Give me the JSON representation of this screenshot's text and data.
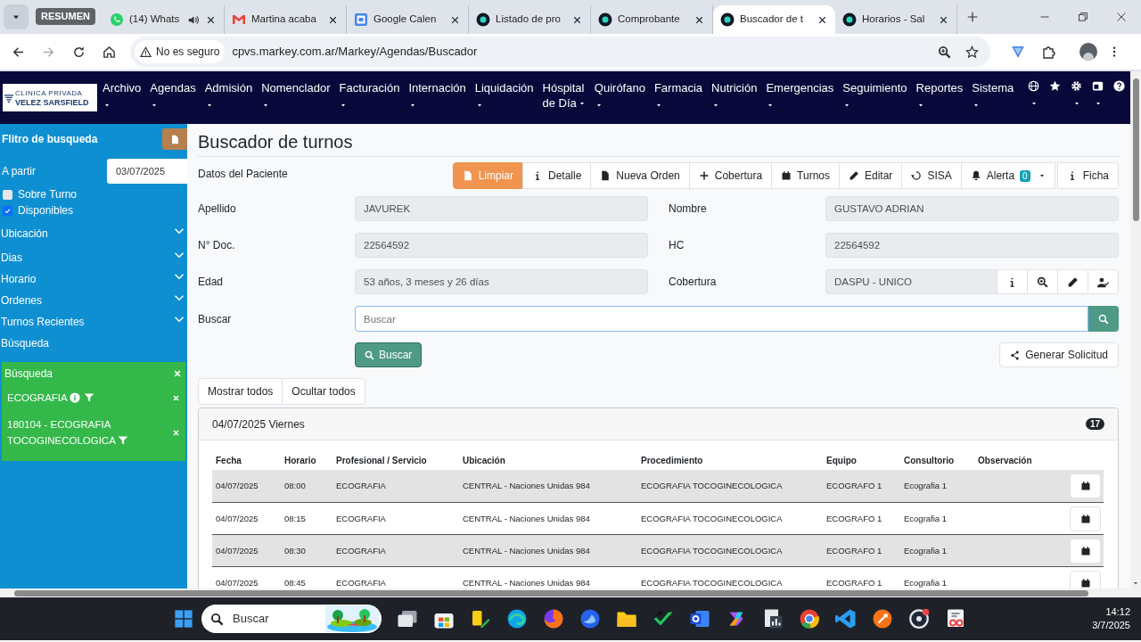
{
  "browser": {
    "tab_group": "RESUMEN",
    "tabs": [
      {
        "title": "(14) Whats",
        "kind": "chat",
        "audio": true,
        "selected": false
      },
      {
        "title": "Martina acaba",
        "kind": "mail",
        "audio": false,
        "selected": false
      },
      {
        "title": "Google Calen",
        "kind": "calendar",
        "audio": false,
        "selected": false
      },
      {
        "title": "Listado de pro",
        "kind": "site",
        "audio": false,
        "selected": false
      },
      {
        "title": "Comprobante",
        "kind": "site",
        "audio": false,
        "selected": false
      },
      {
        "title": "Buscador de t",
        "kind": "site",
        "audio": false,
        "selected": true
      },
      {
        "title": "Horarios - Sal",
        "kind": "site",
        "audio": false,
        "selected": false
      }
    ],
    "address": {
      "security": "No es seguro",
      "url": "cpvs.markey.com.ar/Markey/Agendas/Buscador"
    }
  },
  "app": {
    "logo": {
      "line_1": "CLINICA PRIVADA",
      "line_2": "VELEZ SARSFIELD"
    },
    "menu": [
      {
        "label": "Archivo"
      },
      {
        "label": "Agendas"
      },
      {
        "label": "Admisión"
      },
      {
        "label": "Nomenclador"
      },
      {
        "label": "Facturación"
      },
      {
        "label": "Internación"
      },
      {
        "label": "Liquidación"
      },
      {
        "label": "Hóspital",
        "line_2": "de Día"
      },
      {
        "label": "Quirófano"
      },
      {
        "label": "Farmacia"
      },
      {
        "label": "Nutrición"
      },
      {
        "label": "Emergencias"
      },
      {
        "label": "Seguimiento"
      },
      {
        "label": "Reportes"
      },
      {
        "label": "Sistema"
      }
    ]
  },
  "sidebar": {
    "title": "Flitro de busqueda",
    "date_label": "A partir",
    "date_value": "03/07/2025",
    "checkboxes": [
      {
        "label": "Sobre Turno",
        "checked": false
      },
      {
        "label": "Disponibles",
        "checked": true
      }
    ],
    "sections": [
      {
        "label": "Ubicación",
        "collapsible": true
      },
      {
        "label": "Dias",
        "collapsible": true
      },
      {
        "label": "Horario",
        "collapsible": true
      },
      {
        "label": "Ordenes",
        "collapsible": true
      },
      {
        "label": "Turnos Recientes",
        "collapsible": true
      },
      {
        "label": "Búsqueda",
        "collapsible": false
      }
    ],
    "filters": {
      "title": "Búsqueda",
      "items": [
        {
          "label": "ECOGRAFIA",
          "info": true
        },
        {
          "label": "180104 - ECOGRAFIA TOCOGINECOLOGICA",
          "info": false
        }
      ]
    }
  },
  "main": {
    "title": "Buscador de turnos",
    "section": "Datos del Paciente",
    "toolbar": [
      {
        "label": "Limpiar",
        "kind": "file",
        "primary": true
      },
      {
        "label": "Detalle",
        "kind": "info",
        "primary": false
      },
      {
        "label": "Nueva Orden",
        "kind": "file",
        "primary": false
      },
      {
        "label": "Cobertura",
        "kind": "plus",
        "primary": false
      },
      {
        "label": "Turnos",
        "kind": "calendar",
        "primary": false
      },
      {
        "label": "Editar",
        "kind": "pencil",
        "primary": false
      },
      {
        "label": "SISA",
        "kind": "recycle",
        "primary": false
      },
      {
        "label": "Alerta",
        "kind": "bell",
        "primary": false,
        "badge": "0",
        "dropdown": true
      },
      {
        "label": "Ficha",
        "kind": "info",
        "primary": false
      }
    ],
    "fields": [
      {
        "label": "Apellido",
        "value": "JAVUREK"
      },
      {
        "label": "Nombre",
        "value": "GUSTAVO ADRIAN"
      },
      {
        "label": "N° Doc.",
        "value": "22564592"
      },
      {
        "label": "HC",
        "value": "22564592"
      },
      {
        "label": "Edad",
        "value": "53 años, 3 meses y 26 días"
      },
      {
        "label": "Cobertura",
        "value": "DASPU - UNICO",
        "actions": [
          {
            "kind": "info"
          },
          {
            "kind": "zoom"
          },
          {
            "kind": "edit"
          },
          {
            "kind": "user_check"
          }
        ]
      }
    ],
    "search": {
      "label": "Buscar",
      "placeholder": "Buscar"
    },
    "search_button": "Buscar",
    "request_button": "Generar Solicitud",
    "toggles": [
      "Mostrar todos",
      "Ocultar todos"
    ],
    "day": {
      "title": "04/07/2025 Viernes",
      "count": "17",
      "columns": [
        "Fecha",
        "Horario",
        "Profesional / Servicio",
        "Ubicación",
        "Procedimiento",
        "Equipo",
        "Consultorio",
        "Observación"
      ],
      "rows": [
        [
          "04/07/2025",
          "08:00",
          "ECOGRAFIA",
          "CENTRAL - Naciones Unidas 984",
          "ECOGRAFIA TOCOGINECOLOGICA",
          "ECOGRAFO 1",
          "Ecografia 1"
        ],
        [
          "04/07/2025",
          "08:15",
          "ECOGRAFIA",
          "CENTRAL - Naciones Unidas 984",
          "ECOGRAFIA TOCOGINECOLOGICA",
          "ECOGRAFO 1",
          "Ecografia 1"
        ],
        [
          "04/07/2025",
          "08:30",
          "ECOGRAFIA",
          "CENTRAL - Naciones Unidas 984",
          "ECOGRAFIA TOCOGINECOLOGICA",
          "ECOGRAFO 1",
          "Ecografia 1"
        ],
        [
          "04/07/2025",
          "08:45",
          "ECOGRAFIA",
          "CENTRAL - Naciones Unidas 984",
          "ECOGRAFIA TOCOGINECOLOGICA",
          "ECOGRAFO 1",
          "Ecografia 1"
        ]
      ]
    }
  },
  "taskbar": {
    "search": "Buscar",
    "time": "14:12",
    "date": "3/7/2025"
  }
}
